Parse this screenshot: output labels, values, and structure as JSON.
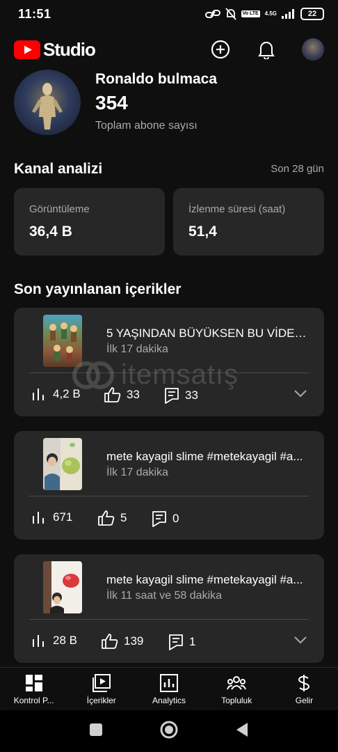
{
  "status_bar": {
    "time": "11:51",
    "network": "4.5G",
    "lte": "Vo LTE",
    "battery": "22"
  },
  "header": {
    "app_name": "Studio"
  },
  "channel": {
    "name": "Ronaldo bulmaca",
    "subscriber_count": "354",
    "subscriber_label": "Toplam abone sayısı"
  },
  "analytics": {
    "title": "Kanal analizi",
    "range": "Son 28 gün",
    "cards": [
      {
        "label": "Görüntüleme",
        "value": "36,4 B"
      },
      {
        "label": "İzlenme süresi (saat)",
        "value": "51,4"
      }
    ]
  },
  "recent": {
    "title": "Son yayınlanan içerikler",
    "items": [
      {
        "title": "5 YAŞINDAN BÜYÜKSEN BU VİDEO...",
        "time": "İlk 17 dakika",
        "views": "4,2 B",
        "likes": "33",
        "comments": "33"
      },
      {
        "title": "mete kayagil slime #metekayagil #a...",
        "time": "İlk 17 dakika",
        "views": "671",
        "likes": "5",
        "comments": "0"
      },
      {
        "title": "mete kayagil slime #metekayagil #a...",
        "time": "İlk 11 saat ve 58 dakika",
        "views": "28 B",
        "likes": "139",
        "comments": "1"
      }
    ]
  },
  "watermark": {
    "text": "itemsatış"
  },
  "bottom_nav": {
    "items": [
      {
        "label": "Kontrol P..."
      },
      {
        "label": "İçerikler"
      },
      {
        "label": "Analytics"
      },
      {
        "label": "Topluluk"
      },
      {
        "label": "Gelir"
      }
    ]
  }
}
